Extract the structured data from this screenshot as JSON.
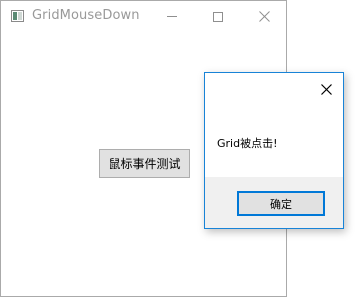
{
  "main_window": {
    "title": "GridMouseDown",
    "icon": "app-window-icon",
    "caption_buttons": [
      "minimize-icon",
      "maximize-icon",
      "close-icon"
    ],
    "button_label": "鼠标事件测试"
  },
  "message_box": {
    "message": "Grid被点击!",
    "ok_label": "确定",
    "close_icon": "close-icon",
    "accent_color": "#0078d7",
    "footer_color": "#f0f0f0"
  }
}
